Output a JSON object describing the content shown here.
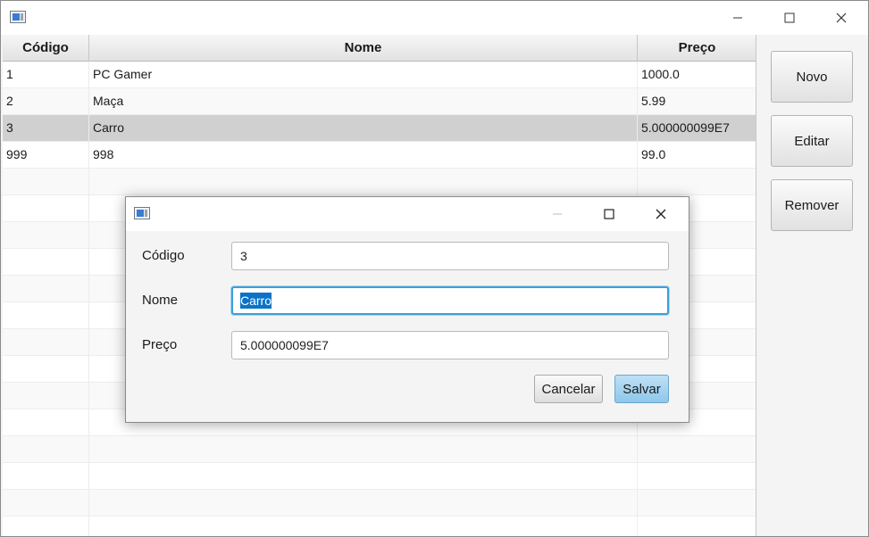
{
  "window": {
    "title": "",
    "icon": "java-app-icon",
    "controls": {
      "minimize": "minimize-icon",
      "maximize": "maximize-icon",
      "close": "close-icon"
    }
  },
  "table": {
    "columns": [
      "Código",
      "Nome",
      "Preço"
    ],
    "rows": [
      {
        "codigo": "1",
        "nome": "PC Gamer",
        "preco": "1000.0"
      },
      {
        "codigo": "2",
        "nome": "Maça",
        "preco": "5.99"
      },
      {
        "codigo": "3",
        "nome": "Carro",
        "preco": "5.000000099E7",
        "selected": true
      },
      {
        "codigo": "999",
        "nome": "998",
        "preco": "99.0"
      }
    ]
  },
  "actions": {
    "novo": "Novo",
    "editar": "Editar",
    "remover": "Remover"
  },
  "dialog": {
    "title": "",
    "fields": {
      "codigo": {
        "label": "Código",
        "value": "3"
      },
      "nome": {
        "label": "Nome",
        "value": "Carro"
      },
      "preco": {
        "label": "Preço",
        "value": "5.000000099E7"
      }
    },
    "cancel_label": "Cancelar",
    "save_label": "Salvar"
  },
  "colors": {
    "selection_row": "#d0d0d0",
    "focus_border": "#3c9fd8",
    "text_selection": "#0a73c8",
    "default_button": "#8ec7ea"
  }
}
